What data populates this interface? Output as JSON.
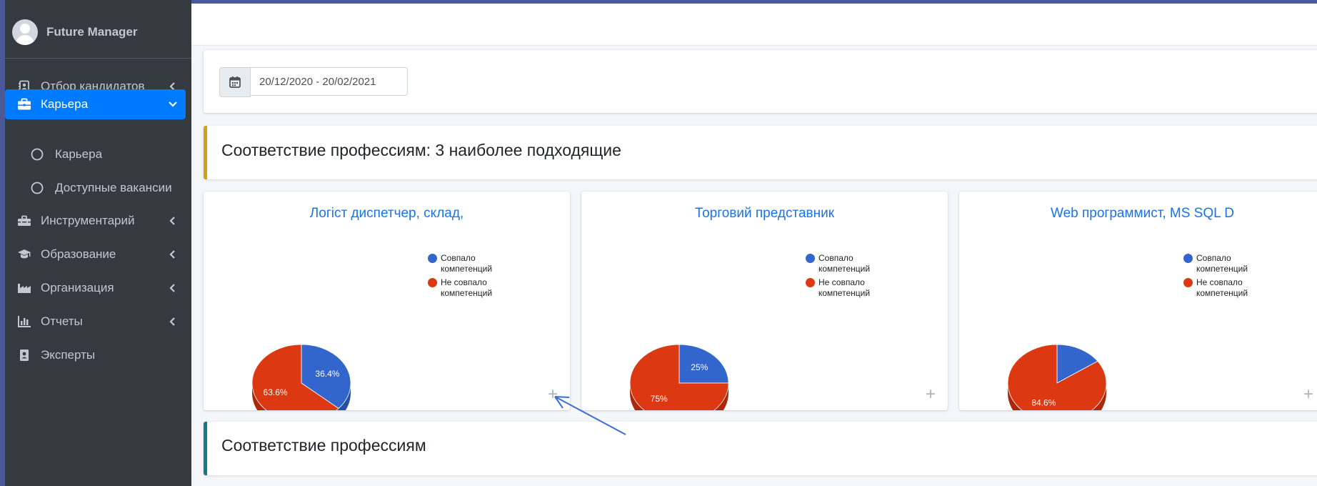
{
  "user": {
    "name": "Future Manager"
  },
  "sidebar": {
    "items": [
      {
        "label": "Отбор кандидатов",
        "icon": "contact-card-icon",
        "arrow": "chevron-left"
      },
      {
        "label": "Карьера",
        "icon": "briefcase-icon",
        "arrow": "chevron-down",
        "active": true
      },
      {
        "label": "Карьера",
        "icon": "circle-icon",
        "sub": true
      },
      {
        "label": "Доступные вакансии",
        "icon": "circle-icon",
        "sub": true
      },
      {
        "label": "Инструментарий",
        "icon": "toolbox-icon",
        "arrow": "chevron-left"
      },
      {
        "label": "Образование",
        "icon": "graduation-cap-icon",
        "arrow": "chevron-left"
      },
      {
        "label": "Организация",
        "icon": "industry-icon",
        "arrow": "chevron-left"
      },
      {
        "label": "Отчеты",
        "icon": "bar-chart-icon",
        "arrow": "chevron-left"
      },
      {
        "label": "Эксперты",
        "icon": "id-badge-icon"
      }
    ]
  },
  "date_range": {
    "value": "20/12/2020 - 20/02/2021"
  },
  "sections": {
    "top3_title": "Соответствие професcиям: 3 наиболее подходящие",
    "all_title": "Соответствие профессиям"
  },
  "colors": {
    "matched": "#3366cc",
    "unmatched": "#dc3912",
    "accent": "#007bff",
    "callout_gold": "#d4a017",
    "callout_teal": "#117a8b"
  },
  "chart_data": [
    {
      "type": "pie",
      "title": "Логіст диспетчер, склад,",
      "categories": [
        "Совпало компетенций",
        "Не совпало компетенций"
      ],
      "values": [
        36.4,
        63.6
      ],
      "labels": [
        "36.4%",
        "63.6%"
      ],
      "legend": "right",
      "legend_items": [
        "Совпало компетенций",
        "Не совпало компетенций"
      ]
    },
    {
      "type": "pie",
      "title": "Торговий представник",
      "categories": [
        "Совпало компетенций",
        "Не совпало компетенций"
      ],
      "values": [
        25,
        75
      ],
      "labels": [
        "25%",
        "75%"
      ],
      "legend": "right",
      "legend_items": [
        "Совпало компетенций",
        "Не совпало компетенций"
      ]
    },
    {
      "type": "pie",
      "title": "Web программист, MS SQL D",
      "categories": [
        "Совпало компетенций",
        "Не совпало компетенций"
      ],
      "values": [
        15.4,
        84.6
      ],
      "labels": [
        "",
        "84.6%"
      ],
      "legend": "right",
      "legend_items": [
        "Совпало компетенций",
        "Не совпало компетенций"
      ]
    }
  ]
}
